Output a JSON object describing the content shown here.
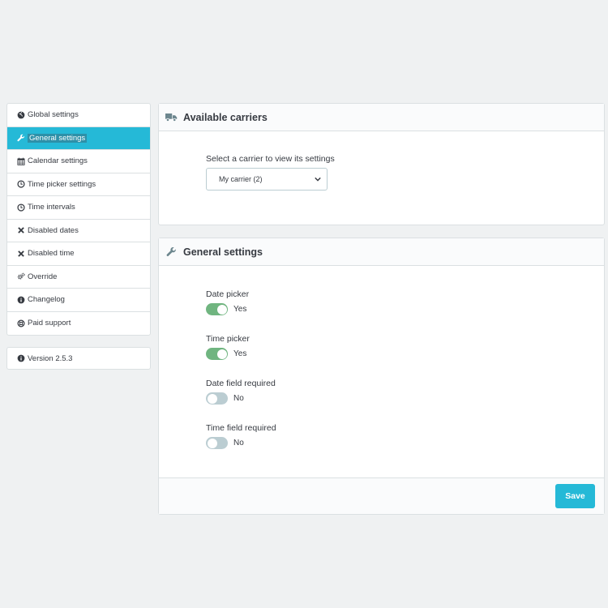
{
  "sidebar": {
    "items": [
      {
        "label": "Global settings",
        "icon": "globe-icon"
      },
      {
        "label": "General settings",
        "icon": "wrench-icon",
        "active": true
      },
      {
        "label": "Calendar settings",
        "icon": "calendar-icon"
      },
      {
        "label": "Time picker settings",
        "icon": "clock-icon"
      },
      {
        "label": "Time intervals",
        "icon": "clock-icon"
      },
      {
        "label": "Disabled dates",
        "icon": "times-icon"
      },
      {
        "label": "Disabled time",
        "icon": "times-icon"
      },
      {
        "label": "Override",
        "icon": "cogs-icon"
      },
      {
        "label": "Changelog",
        "icon": "info-circle-icon"
      },
      {
        "label": "Paid support",
        "icon": "life-ring-icon"
      }
    ],
    "version": {
      "label": "Version 2.5.3",
      "icon": "info-circle-icon"
    }
  },
  "carriers_panel": {
    "title": "Available carriers",
    "icon": "truck-icon",
    "select_label": "Select a carrier to view its settings",
    "select_value": "My carrier (2)"
  },
  "general_panel": {
    "title": "General settings",
    "icon": "wrench-icon",
    "toggles": [
      {
        "label": "Date picker",
        "state": "Yes",
        "on": true
      },
      {
        "label": "Time picker",
        "state": "Yes",
        "on": true
      },
      {
        "label": "Date field required",
        "state": "No",
        "on": false
      },
      {
        "label": "Time field required",
        "state": "No",
        "on": false
      }
    ],
    "save_label": "Save"
  },
  "colors": {
    "accent": "#25b9d7",
    "toggle_on": "#70b580",
    "toggle_off": "#bbcdd2",
    "background": "#eff1f2"
  }
}
